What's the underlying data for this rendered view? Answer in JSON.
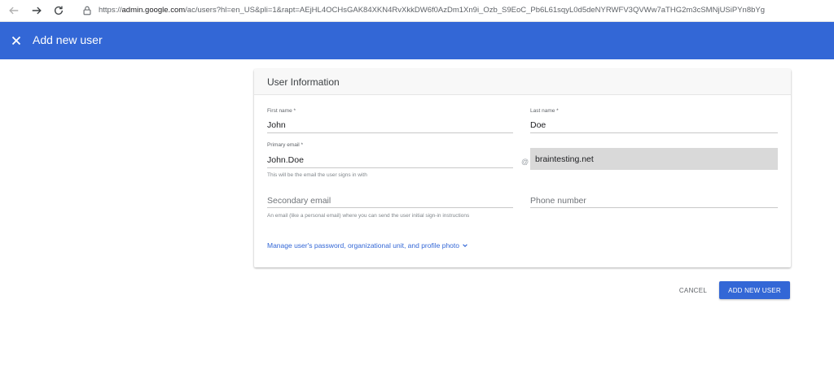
{
  "browser": {
    "url_prefix": "https://",
    "url_host": "admin.google.com",
    "url_rest": "/ac/users?hl=en_US&pli=1&rapt=AEjHL4OCHsGAK84XKN4RvXkkDW6f0AzDm1Xn9i_Ozb_S9EoC_Pb6L61sqyL0d5deNYRWFV3QVWw7aTHG2m3cSMNjUSiPYn8bYg"
  },
  "header": {
    "title": "Add new user",
    "background_color": "#3367d6"
  },
  "card": {
    "title": "User Information",
    "first_name": {
      "label": "First name *",
      "value": "John"
    },
    "last_name": {
      "label": "Last name *",
      "value": "Doe"
    },
    "primary_email": {
      "label": "Primary email *",
      "value": "John.Doe",
      "hint": "This will be the email the user signs in with"
    },
    "at_sign": "@",
    "domain": "braintesting.net",
    "secondary_email": {
      "placeholder": "Secondary email",
      "hint": "An email (like a personal email) where you can send the user initial sign-in instructions"
    },
    "phone_number": {
      "placeholder": "Phone number"
    },
    "manage_link": "Manage user's password, organizational unit, and profile photo"
  },
  "actions": {
    "cancel_label": "CANCEL",
    "add_label": "ADD NEW USER"
  },
  "icons": {
    "back": "back-arrow-icon",
    "forward": "forward-arrow-icon",
    "reload": "reload-icon",
    "site_info": "site-info-icon",
    "close": "close-icon",
    "chevron": "chevron-down-icon"
  }
}
